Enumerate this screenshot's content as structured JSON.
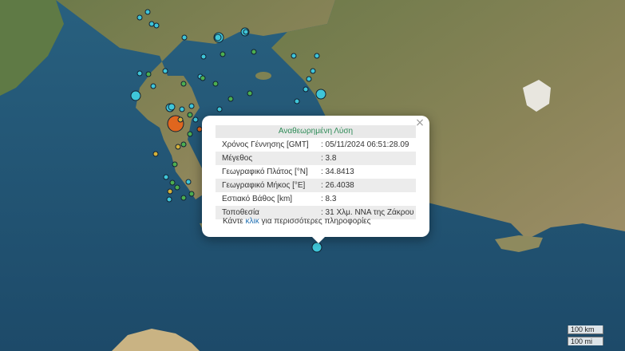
{
  "popup": {
    "title": "Αναθεωρημένη Λύση",
    "rows": [
      {
        "label": "Χρόνος Γέννησης [GMT]",
        "value": ": 05/11/2024 06:51:28.09"
      },
      {
        "label": "Μέγεθος",
        "value": ": 3.8"
      },
      {
        "label": "Γεωγραφικό Πλάτος [°N]",
        "value": ": 34.8413"
      },
      {
        "label": "Γεωγραφικό Μήκος [°E]",
        "value": ": 26.4038"
      },
      {
        "label": "Εστιακό Βάθος [km]",
        "value": ": 8.3"
      },
      {
        "label": "Τοποθεσία",
        "value": ": 31 Χλμ. ΝΝΑ της Ζάκρου"
      }
    ],
    "more_prefix": "Κάντε ",
    "more_link": "κλικ",
    "more_suffix": " για περισσότερες πληροφορίες",
    "close_glyph": "×"
  },
  "scale": {
    "km": "100 km",
    "mi": "100 mi"
  },
  "colors": {
    "sea": "#1f4f6e",
    "land": "#6f7d4e",
    "event_recent": "#3fc6d9",
    "event_old": "#4caf50",
    "event_mid": "#d4b13a",
    "event_large": "#e0661e",
    "title_green": "#2e8b57",
    "link_blue": "#1f6fb2"
  }
}
